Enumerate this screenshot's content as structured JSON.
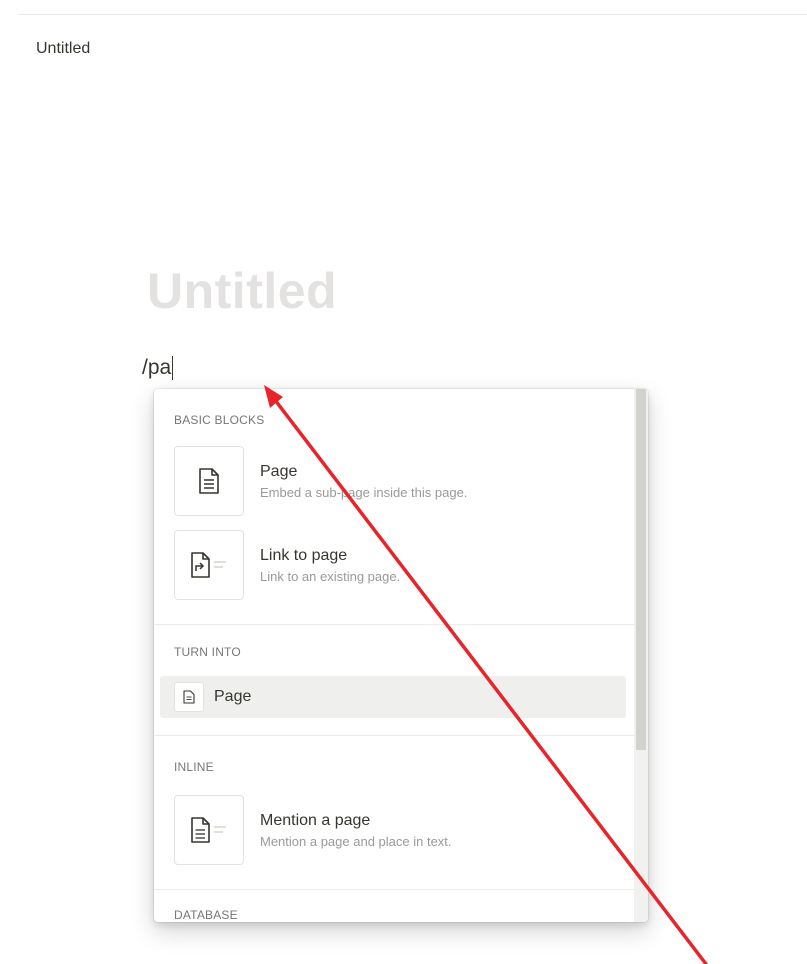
{
  "breadcrumb": {
    "page": "Untitled"
  },
  "page": {
    "title": "Untitled",
    "input_value": "/pa"
  },
  "menu": {
    "sections": {
      "basic_blocks": "BASIC BLOCKS",
      "turn_into": "TURN INTO",
      "inline": "INLINE",
      "database": "DATABASE"
    },
    "items": {
      "page": {
        "title": "Page",
        "description": "Embed a sub-page inside this page."
      },
      "link_to_page": {
        "title": "Link to page",
        "description": "Link to an existing page."
      },
      "turn_into_page": {
        "title": "Page"
      },
      "mention_page": {
        "title": "Mention a page",
        "description": "Mention a page and place in text."
      }
    }
  },
  "colors": {
    "annotation_arrow": "#e8242a",
    "title_placeholder": "#e3e2e0",
    "text": "#37352f",
    "muted": "#9b9a97",
    "highlight": "#efefee"
  }
}
